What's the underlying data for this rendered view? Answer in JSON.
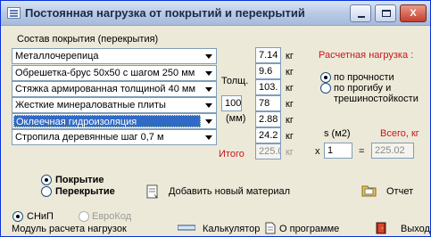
{
  "window": {
    "title": "Постоянная нагрузка от покрытий и перекрытий",
    "minimize_label": "_",
    "maximize_label": "□",
    "close_label": "X"
  },
  "composition": {
    "heading": "Состав покрытия (перекрытия)",
    "layers": [
      {
        "name": "Металлочерепица",
        "weight": "7.14",
        "unit": "кг"
      },
      {
        "name": "Обрешетка-брус 50х50 с шагом 250 мм",
        "weight": "9.6",
        "unit": "кг"
      },
      {
        "name": "Стяжка армированная толщиной 40 мм",
        "weight": "103.",
        "unit": "кг"
      },
      {
        "name": "Жесткие минераловатные плиты",
        "weight": "78",
        "unit": "кг"
      },
      {
        "name": "Оклеечная гидроизоляция",
        "weight": "2.88",
        "unit": "кг"
      },
      {
        "name": "Стропила деревянные шаг 0,7 м",
        "weight": "24.2",
        "unit": "кг"
      }
    ],
    "thickness_label": "Толщ.",
    "thickness_value": "100",
    "thickness_unit": "(мм)",
    "total_label": "Итого",
    "total_value": "225.0",
    "total_unit": "кг"
  },
  "calc_load": {
    "heading": "Расчетная нагрузка :",
    "options": [
      {
        "label": "по прочности",
        "checked": true
      },
      {
        "label": "по прогибу и",
        "label2": "трешиностойкости",
        "checked": false
      }
    ]
  },
  "area": {
    "s_label": "s (м2)",
    "total_label": "Всего, кг",
    "x_sign": "x",
    "s_value": "1",
    "eq_sign": "=",
    "total_value": "225.02"
  },
  "type": {
    "options": [
      {
        "label": "Покрытие",
        "checked": true
      },
      {
        "label": "Перекрытие",
        "checked": false
      }
    ]
  },
  "actions": {
    "add_material": "Добавить новый материал",
    "report": "Отчет"
  },
  "norms": {
    "options": [
      {
        "label": "СНиП",
        "checked": true,
        "enabled": true
      },
      {
        "label": "ЕвроКод",
        "checked": false,
        "enabled": false
      }
    ]
  },
  "footer": {
    "module_label": "Модуль расчета нагрузок",
    "calculator": "Калькулятор",
    "about": "О программе",
    "exit": "Выход"
  },
  "colors": {
    "accent_red": "#c8161e",
    "selection_blue": "#316ac5"
  }
}
